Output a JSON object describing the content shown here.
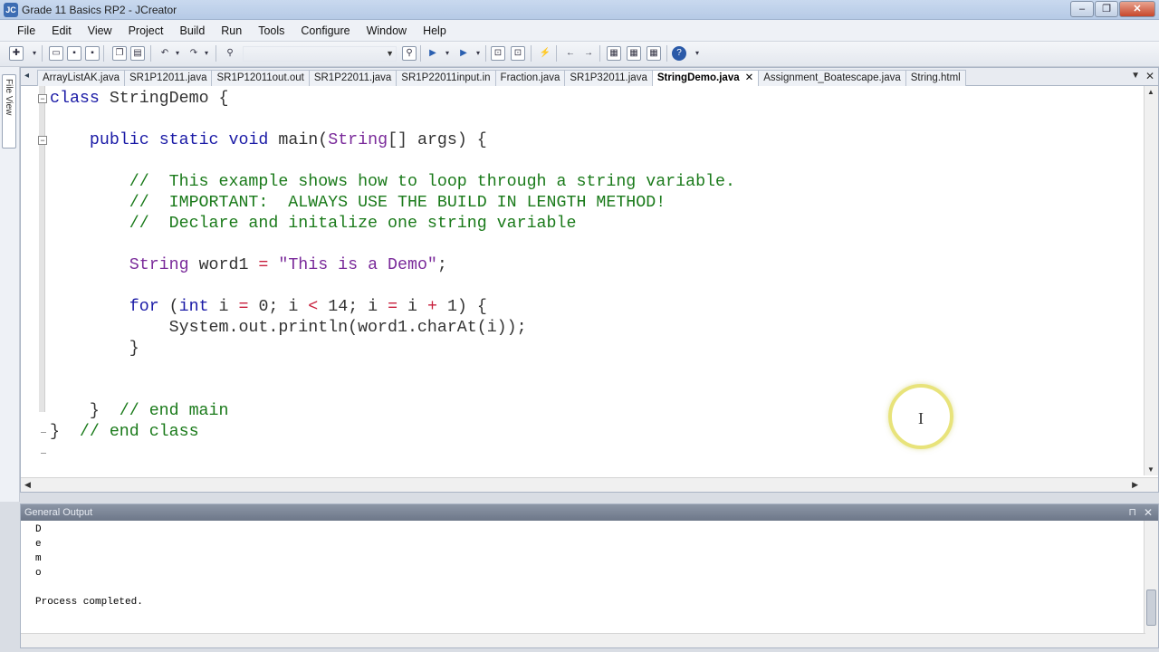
{
  "window": {
    "title": "Grade 11 Basics RP2 - JCreator",
    "app_icon": "JC"
  },
  "window_buttons": {
    "minimize": "–",
    "maximize": "❐",
    "close": "✕"
  },
  "menu": [
    "File",
    "Edit",
    "View",
    "Project",
    "Build",
    "Run",
    "Tools",
    "Configure",
    "Window",
    "Help"
  ],
  "side_panel": {
    "label": "File View"
  },
  "tabs": [
    {
      "label": "ArrayListAK.java",
      "active": false
    },
    {
      "label": "SR1P12011.java",
      "active": false
    },
    {
      "label": "SR1P12011out.out",
      "active": false
    },
    {
      "label": "SR1P22011.java",
      "active": false
    },
    {
      "label": "SR1P22011input.in",
      "active": false
    },
    {
      "label": "Fraction.java",
      "active": false
    },
    {
      "label": "SR1P32011.java",
      "active": false
    },
    {
      "label": "StringDemo.java",
      "active": true
    },
    {
      "label": "Assignment_Boatescape.java",
      "active": false
    },
    {
      "label": "String.html",
      "active": false
    }
  ],
  "tab_close": "✕",
  "code_lines": [
    "class StringDemo {",
    "",
    "    public static void main(String[] args) {",
    "",
    "        //  This example shows how to loop through a string variable.",
    "        //  IMPORTANT:  ALWAYS USE THE BUILD IN LENGTH METHOD!",
    "        //  Declare and initalize one string variable",
    "",
    "        String word1 = \"This is a Demo\";",
    "",
    "        for (int i = 0; i < 14; i = i + 1) {",
    "            System.out.println(word1.charAt(i));",
    "        }",
    "",
    "",
    "    }  // end main",
    "}  // end class"
  ],
  "output": {
    "title": "General Output",
    "lines": [
      "D",
      "e",
      "m",
      "o",
      "",
      "Process completed."
    ]
  },
  "colors": {
    "keyword": "#1a1aa6",
    "type": "#7a2a9a",
    "comment": "#1a7a1a",
    "string": "#7a2a9a",
    "operator": "#c81f3c"
  }
}
